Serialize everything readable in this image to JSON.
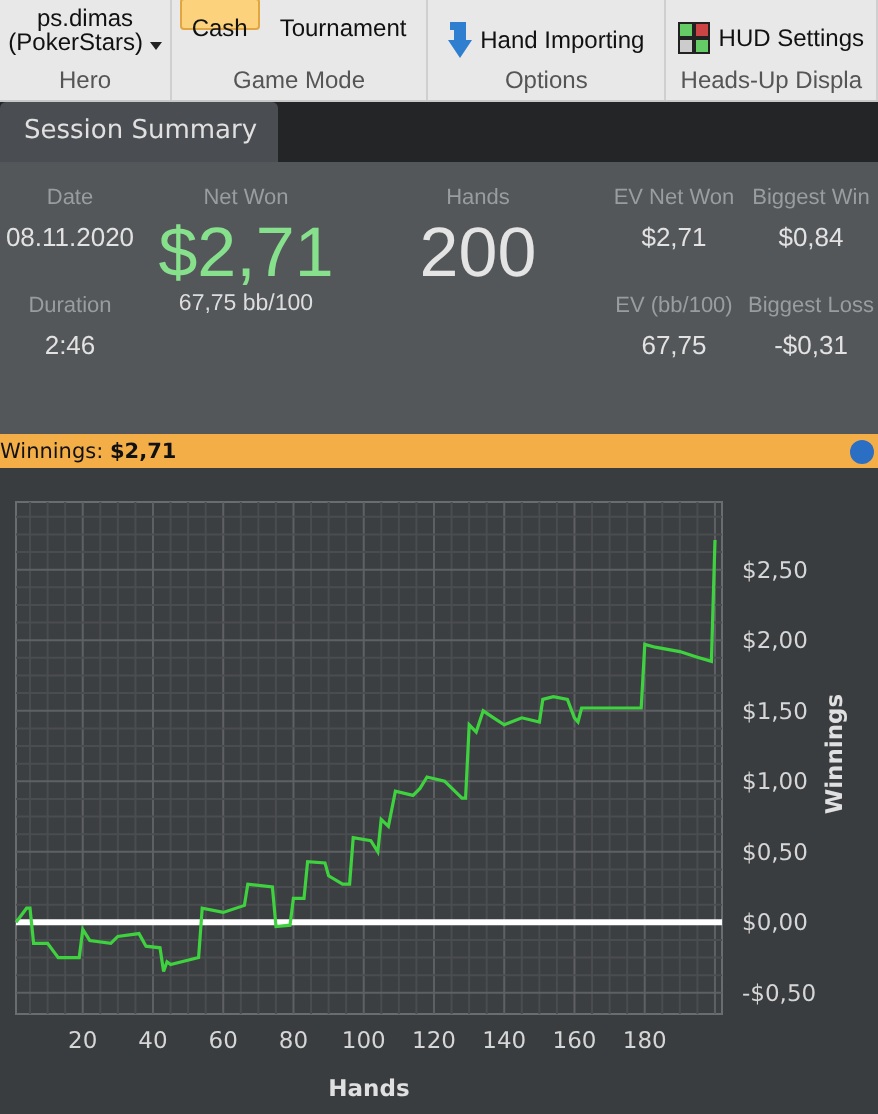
{
  "ribbon": {
    "groups": [
      {
        "kind": "hero",
        "label": "Hero",
        "account": "ps.dimas",
        "site": "(PokerStars)"
      },
      {
        "kind": "modes",
        "label": "Game Mode",
        "modes": [
          {
            "label": "Cash",
            "selected": true
          },
          {
            "label": "Tournament",
            "selected": false
          }
        ]
      },
      {
        "kind": "import",
        "label": "Options",
        "command": "Hand Importing"
      },
      {
        "kind": "hud",
        "label": "Heads-Up Displa",
        "command": "HUD Settings"
      }
    ]
  },
  "tabs": [
    {
      "label": "Session Summary",
      "selected": true
    }
  ],
  "summary": {
    "date": {
      "label": "Date",
      "value": "08.11.2020"
    },
    "duration": {
      "label": "Duration",
      "value": "2:46"
    },
    "net_won": {
      "label": "Net Won",
      "value": "$2,71",
      "rate": "67,75 bb/100"
    },
    "hands": {
      "label": "Hands",
      "value": "200"
    },
    "ev_net_won": {
      "label": "EV Net Won",
      "value": "$2,71"
    },
    "biggest_win": {
      "label": "Biggest Win",
      "value": "$0,84"
    },
    "ev_bb100": {
      "label": "EV (bb/100)",
      "value": "67,75"
    },
    "biggest_loss": {
      "label": "Biggest Loss",
      "value": "-$0,31"
    }
  },
  "winnings_bar": {
    "text": "Winnings: **$2,71**"
  },
  "chart": {
    "chart_data": {
      "type": "line",
      "xlabel": "Hands",
      "ylabel": "Winnings",
      "x": [
        1,
        4,
        5,
        6,
        10,
        13,
        19,
        20,
        22,
        28,
        30,
        36,
        38,
        42,
        43,
        44,
        45,
        53,
        54,
        60,
        66,
        67,
        74,
        75,
        79,
        80,
        83,
        84,
        89,
        90,
        94,
        96,
        97,
        102,
        104,
        105,
        107,
        109,
        114,
        116,
        118,
        123,
        128,
        129,
        130,
        132,
        134,
        137,
        140,
        145,
        150,
        151,
        154,
        158,
        160,
        161,
        162,
        179,
        180,
        183,
        190,
        195,
        199,
        200
      ],
      "series": [
        {
          "color": "#3fd23f",
          "values": [
            0,
            0.1,
            0.1,
            -0.15,
            -0.15,
            -0.25,
            -0.25,
            -0.05,
            -0.13,
            -0.15,
            -0.1,
            -0.08,
            -0.17,
            -0.18,
            -0.35,
            -0.28,
            -0.3,
            -0.25,
            0.1,
            0.07,
            0.12,
            0.27,
            0.25,
            -0.03,
            -0.02,
            0.17,
            0.17,
            0.43,
            0.42,
            0.33,
            0.27,
            0.27,
            0.6,
            0.58,
            0.5,
            0.73,
            0.68,
            0.93,
            0.9,
            0.95,
            1.03,
            1.0,
            0.88,
            0.88,
            1.4,
            1.35,
            1.5,
            1.45,
            1.4,
            1.45,
            1.42,
            1.58,
            1.6,
            1.58,
            1.45,
            1.42,
            1.52,
            1.52,
            1.97,
            1.95,
            1.92,
            1.88,
            1.85,
            2.71
          ]
        }
      ],
      "grid": true,
      "xlim": [
        1,
        202
      ],
      "ylim": [
        -0.65,
        2.98
      ],
      "xticks": [
        20,
        40,
        60,
        80,
        100,
        120,
        140,
        160,
        180
      ],
      "yticks": [
        {
          "value": 2.5,
          "label": "$2,50"
        },
        {
          "value": 2,
          "label": "$2,00"
        },
        {
          "value": 1.5,
          "label": "$1,50"
        },
        {
          "value": 1,
          "label": "$1,00"
        },
        {
          "value": 0.5,
          "label": "$0,50"
        },
        {
          "value": 0,
          "label": "$0,00"
        },
        {
          "value": -0.5,
          "label": "-$0,50"
        }
      ]
    }
  }
}
